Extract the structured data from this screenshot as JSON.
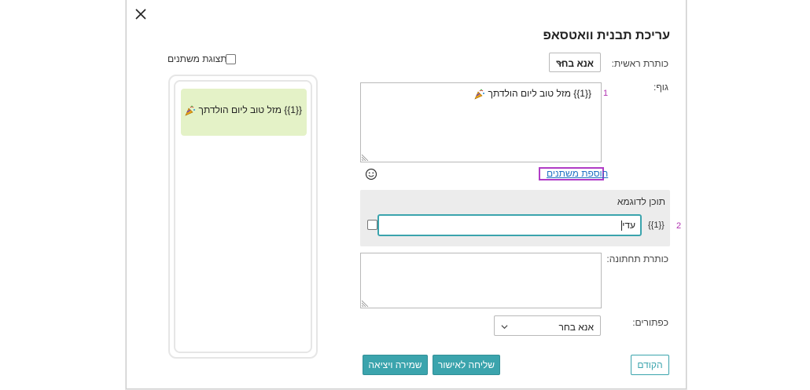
{
  "dialog": {
    "title": "עריכת תבנית וואטסאפ",
    "close_icon": "close-icon"
  },
  "header_field": {
    "label": "כותרת ראשית:",
    "value": "אנא בחר",
    "icon": "chevron-down-icon"
  },
  "body_field": {
    "label": "גוף:",
    "line_number": "1",
    "text": "{{1}} מזל טוב ליום הולדתך",
    "emoji_icon": "party-popper-icon",
    "resize_icon": "resize-grip-icon"
  },
  "add_variables_link": "הוספת משתנים",
  "emoji_button_icon": "smiley-icon",
  "sample_content": {
    "title": "תוכן לדוגמא",
    "line_number": "2",
    "variable_label": "{{1}}",
    "value": "עדי"
  },
  "footer_field": {
    "label": "כותרת תחתונה:",
    "value": ""
  },
  "buttons_field": {
    "label": "כפתורים:",
    "value": "אנא בחר"
  },
  "actions": {
    "previous": "הקודם",
    "send_for_approval": "שליחה לאישור",
    "save_and_exit": "שמירה ויציאה"
  },
  "preview": {
    "checkbox_label": "תצוגת משתנים",
    "bubble_text": "{{1}} מזל טוב ליום הולדתך"
  },
  "colors": {
    "accent": "#3ba4ad",
    "highlight_border": "#b03cc6",
    "link": "#1f72c4",
    "bubble_bg": "#e4f2c7"
  }
}
